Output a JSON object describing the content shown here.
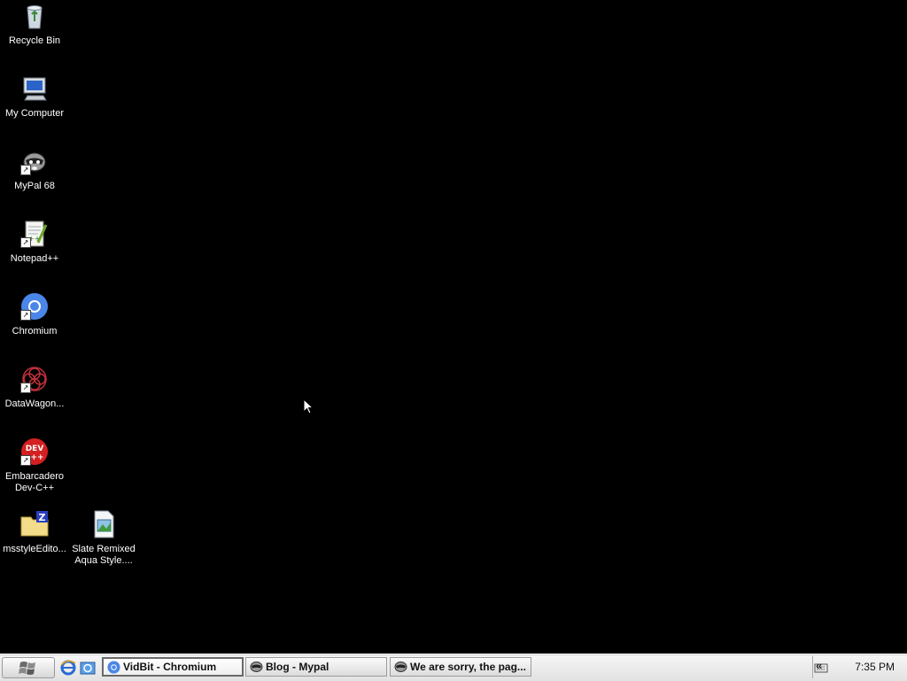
{
  "desktop": {
    "background_color": "#000000",
    "icons": [
      {
        "label": "Recycle Bin",
        "icon": "recycle-bin-icon",
        "shortcut": false
      },
      {
        "label": "My Computer",
        "icon": "my-computer-icon",
        "shortcut": false
      },
      {
        "label": "MyPal 68",
        "icon": "mypal-raccoon-icon",
        "shortcut": true
      },
      {
        "label": "Notepad++",
        "icon": "notepadpp-icon",
        "shortcut": true
      },
      {
        "label": "Chromium",
        "icon": "chromium-icon",
        "shortcut": true
      },
      {
        "label": "DataWagon...",
        "icon": "datawagon-icon",
        "shortcut": true
      },
      {
        "label": "Embarcadero\nDev-C++",
        "icon": "devcpp-icon",
        "shortcut": true
      },
      {
        "label": "msstyleEdito...",
        "icon": "msstyle-editor-icon",
        "shortcut": false
      },
      {
        "label": "Slate Remixed\nAqua Style....",
        "icon": "theme-file-icon",
        "shortcut": false
      }
    ]
  },
  "taskbar": {
    "start_icon": "windows-logo-icon",
    "quick_launch": [
      "internet-explorer-icon",
      "outlook-express-icon"
    ],
    "tasks": [
      {
        "label": "VidBit - Chromium",
        "icon": "chromium-icon",
        "active": true
      },
      {
        "label": "Blog - Mypal",
        "icon": "mypal-raccoon-icon",
        "active": false
      },
      {
        "label": "We are sorry, the pag...",
        "icon": "mypal-raccoon-icon",
        "active": false
      }
    ],
    "tray": {
      "expand_glyph": "«",
      "keyboard_icon": "keyboard-icon",
      "clock": "7:35 PM"
    }
  }
}
